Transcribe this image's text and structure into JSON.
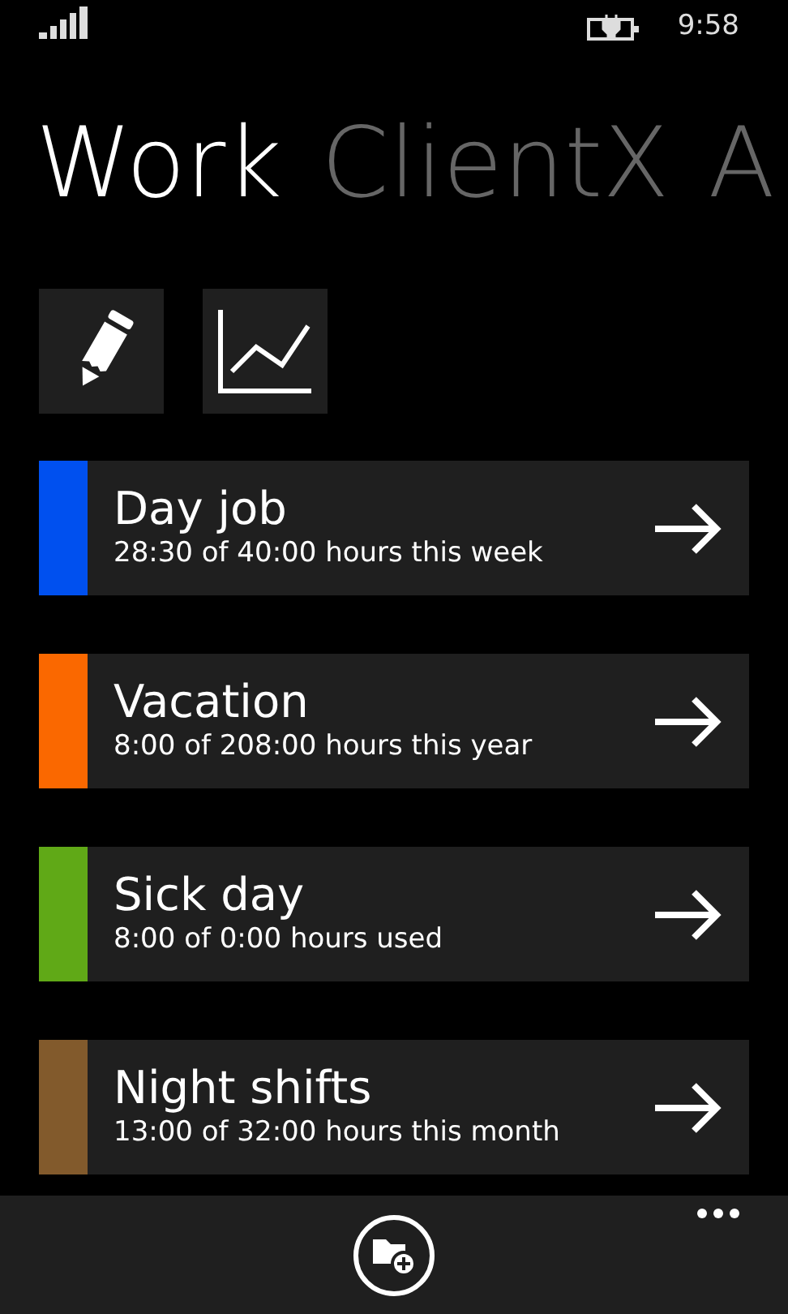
{
  "status_bar": {
    "time": "9:58"
  },
  "pivot": [
    {
      "label": "Work",
      "selected": true
    },
    {
      "label": "ClientX",
      "selected": false
    },
    {
      "label": "A",
      "selected": false
    }
  ],
  "categories": [
    {
      "name": "Day job",
      "summary": "28:30 of 40:00 hours this week",
      "color": "#0050ef"
    },
    {
      "name": "Vacation",
      "summary": "8:00 of 208:00 hours this year",
      "color": "#fa6800"
    },
    {
      "name": "Sick day",
      "summary": "8:00 of 0:00 hours used",
      "color": "#60a917"
    },
    {
      "name": "Night shifts",
      "summary": "13:00 of 32:00 hours this month",
      "color": "#825a2c"
    }
  ]
}
